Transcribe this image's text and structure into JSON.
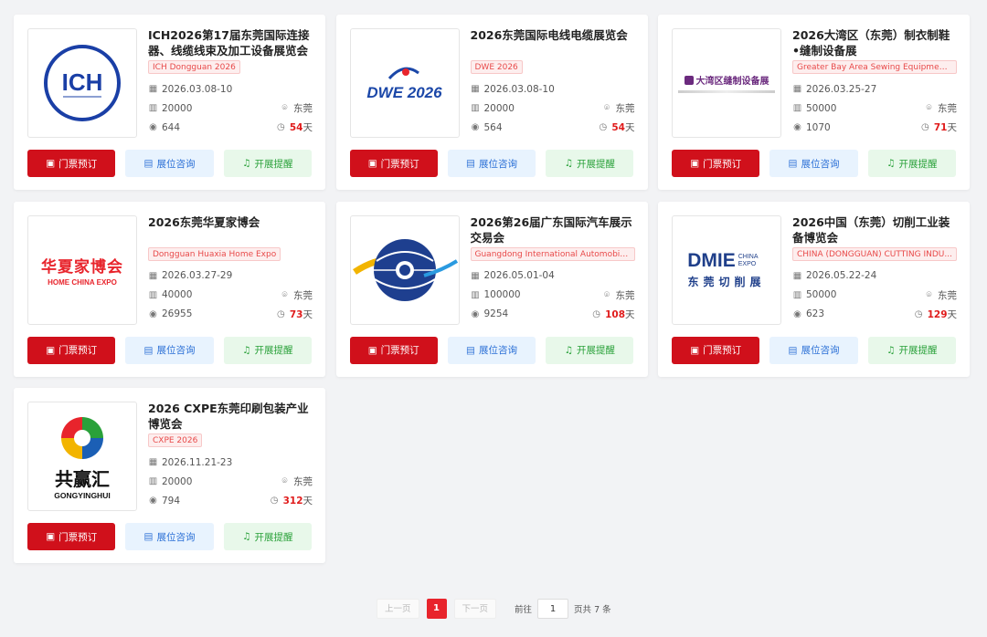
{
  "labels": {
    "ticket": "门票预订",
    "booth": "展位咨询",
    "remind": "开展提醒"
  },
  "expos": [
    {
      "title": "ICH2026第17届东莞国际连接器、线缆线束及加工设备展览会",
      "tag": "ICH Dongguan 2026",
      "date": "2026.03.08-10",
      "area": "20000",
      "city": "东莞",
      "views": "644",
      "days": "54",
      "days_unit": "天",
      "logo": "ich-logo"
    },
    {
      "title": "2026东莞国际电线电缆展览会",
      "tag": "DWE 2026",
      "date": "2026.03.08-10",
      "area": "20000",
      "city": "东莞",
      "views": "564",
      "days": "54",
      "days_unit": "天",
      "logo": "dwe-logo",
      "logo_text": "DWE 2026"
    },
    {
      "title": "2026大湾区（东莞）制衣制鞋•缝制设备展",
      "tag": "Greater Bay Area Sewing Equipment E...",
      "date": "2026.03.25-27",
      "area": "50000",
      "city": "东莞",
      "views": "1070",
      "days": "71",
      "days_unit": "天",
      "logo": "sewing-expo-logo",
      "logo_text": "大湾区缝制设备展"
    },
    {
      "title": "2026东莞华夏家博会",
      "tag": "Dongguan Huaxia Home Expo",
      "date": "2026.03.27-29",
      "area": "40000",
      "city": "东莞",
      "views": "26955",
      "days": "73",
      "days_unit": "天",
      "logo": "huaxia-logo",
      "logo_text": "华夏家博会",
      "logo_sub": "HOME CHINA EXPO"
    },
    {
      "title": "2026第26届广东国际汽车展示交易会",
      "tag": "Guangdong International Automobile ...",
      "date": "2026.05.01-04",
      "area": "100000",
      "city": "东莞",
      "views": "9254",
      "days": "108",
      "days_unit": "天",
      "logo": "auto-expo-logo"
    },
    {
      "title": "2026中国（东莞）切削工业装备博览会",
      "tag": "CHINA (DONGGUAN) CUTTING INDU...",
      "date": "2026.05.22-24",
      "area": "50000",
      "city": "东莞",
      "views": "623",
      "days": "129",
      "days_unit": "天",
      "logo": "dmie-logo",
      "logo_text": "DMIE",
      "logo_sub": "CHINA EXPO",
      "logo_cn": "东莞切削展"
    },
    {
      "title": "2026 CXPE东莞印刷包装产业博览会",
      "tag": "CXPE 2026",
      "date": "2026.11.21-23",
      "area": "20000",
      "city": "东莞",
      "views": "794",
      "days": "312",
      "days_unit": "天",
      "logo": "gongyinghui-logo",
      "logo_text": "共赢汇",
      "logo_sub": "GONGYINGHUI"
    }
  ],
  "pager": {
    "prev": "上一页",
    "current": "1",
    "next": "下一页",
    "goto": "前往",
    "page_value": "1",
    "total": "页共 7 条"
  }
}
